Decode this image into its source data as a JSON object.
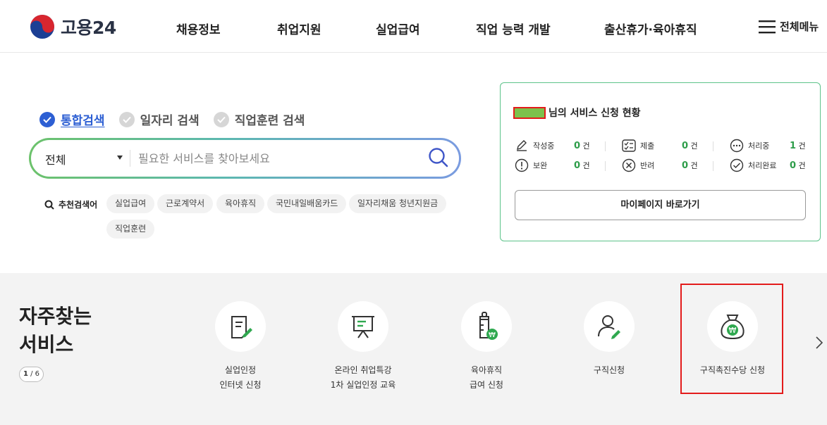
{
  "header": {
    "logo_text": "고용24",
    "nav": [
      "채용정보",
      "취업지원",
      "실업급여",
      "직업 능력 개발",
      "출산휴가·육아휴직"
    ],
    "menu_label": "전체메뉴"
  },
  "search": {
    "tabs": [
      {
        "label": "통합검색",
        "active": true
      },
      {
        "label": "일자리 검색",
        "active": false
      },
      {
        "label": "직업훈련 검색",
        "active": false
      }
    ],
    "scope": "전체",
    "placeholder": "필요한 서비스를 찾아보세요",
    "recommended_label": "추천검색어",
    "recommended": [
      "실업급여",
      "근로계약서",
      "육아휴직",
      "국민내일배움카드",
      "일자리채움 청년지원금",
      "직업훈련"
    ]
  },
  "status": {
    "title_suffix": "님의 서비스 신청 현황",
    "items": [
      {
        "label": "작성중",
        "count": "0",
        "unit": "건",
        "icon": "pencil-icon"
      },
      {
        "label": "제출",
        "count": "0",
        "unit": "건",
        "icon": "checklist-icon"
      },
      {
        "label": "처리중",
        "count": "1",
        "unit": "건",
        "icon": "more-icon"
      },
      {
        "label": "보완",
        "count": "0",
        "unit": "건",
        "icon": "alert-icon"
      },
      {
        "label": "반려",
        "count": "0",
        "unit": "건",
        "icon": "reject-icon"
      },
      {
        "label": "처리완료",
        "count": "0",
        "unit": "건",
        "icon": "check-circle-icon"
      }
    ],
    "mypage_button": "마이페이지 바로가기"
  },
  "favorites": {
    "title_line1": "자주찾는",
    "title_line2": "서비스",
    "pager_current": "1",
    "pager_total": "6",
    "services": [
      {
        "label": "실업인정\n인터넷 신청",
        "icon": "document-edit-icon"
      },
      {
        "label": "온라인 취업특강\n1차 실업인정 교육",
        "icon": "presentation-board-icon"
      },
      {
        "label": "육아휴직\n급여 신청",
        "icon": "baby-bottle-icon"
      },
      {
        "label": "구직신청",
        "icon": "person-edit-icon"
      },
      {
        "label": "구직촉진수당 신청",
        "icon": "money-bag-icon"
      }
    ]
  },
  "colors": {
    "accent_blue": "#2d5fd3",
    "accent_green": "#2e9d4a",
    "highlight_red": "#e31b1b"
  }
}
